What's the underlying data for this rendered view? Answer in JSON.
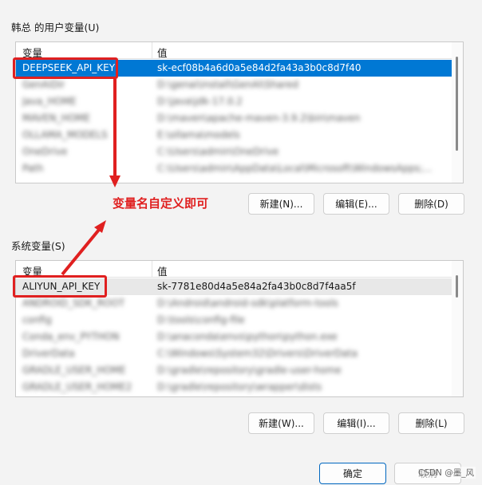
{
  "user_vars": {
    "group_label": "韩总 的用户变量(U)",
    "col_name": "变量",
    "col_value": "值",
    "rows": [
      {
        "name": "DEEPSEEK_API_KEY",
        "value": "sk-ecf08b4a6d0a5e84d2fa43a3b0c8d7f40"
      },
      {
        "name": "GenAiDir",
        "value": "D:\\genai\\install\\GenAI\\Shared"
      },
      {
        "name": "Java_HOME",
        "value": "D:\\java\\jdk-17.0.2"
      },
      {
        "name": "MAVEN_HOME",
        "value": "D:\\maven\\apache-maven-3.9.2\\bin\\maven"
      },
      {
        "name": "OLLAMA_MODELS",
        "value": "E:\\ollama\\models"
      },
      {
        "name": "OneDrive",
        "value": "C:\\Users\\admin\\OneDrive"
      },
      {
        "name": "Path",
        "value": "C:\\Users\\admin\\AppData\\Local\\Microsoft\\WindowsApps;..."
      }
    ],
    "buttons": {
      "new": "新建(N)...",
      "edit": "编辑(E)...",
      "delete": "删除(D)"
    }
  },
  "sys_vars": {
    "group_label": "系统变量(S)",
    "col_name": "变量",
    "col_value": "值",
    "rows": [
      {
        "name": "ALIYUN_API_KEY",
        "value": "sk-7781e80d4a5e84a2fa43b0c8d7f4aa5f"
      },
      {
        "name": "ANDROID_SDK_ROOT",
        "value": "D:\\Android\\android-sdk\\platform-tools"
      },
      {
        "name": "config",
        "value": "D:\\tools\\config-file"
      },
      {
        "name": "Conda_env_PYTHON",
        "value": "D:\\anaconda\\envs\\python\\python.exe"
      },
      {
        "name": "DriverData",
        "value": "C:\\Windows\\System32\\Drivers\\DriverData"
      },
      {
        "name": "GRADLE_USER_HOME",
        "value": "D:\\gradle\\repository\\gradle-user-home"
      },
      {
        "name": "GRADLE_USER_HOME2",
        "value": "D:\\gradle\\repository\\wrapper\\dists"
      }
    ],
    "buttons": {
      "new": "新建(W)...",
      "edit": "编辑(I)...",
      "delete": "删除(L)"
    }
  },
  "annotation": "变量名自定义即可",
  "footer": {
    "ok": "确定",
    "cancel": "取消"
  },
  "watermark": "CSDN @墨_风",
  "colors": {
    "accent": "#0078d4",
    "annotation_red": "#e02020"
  }
}
